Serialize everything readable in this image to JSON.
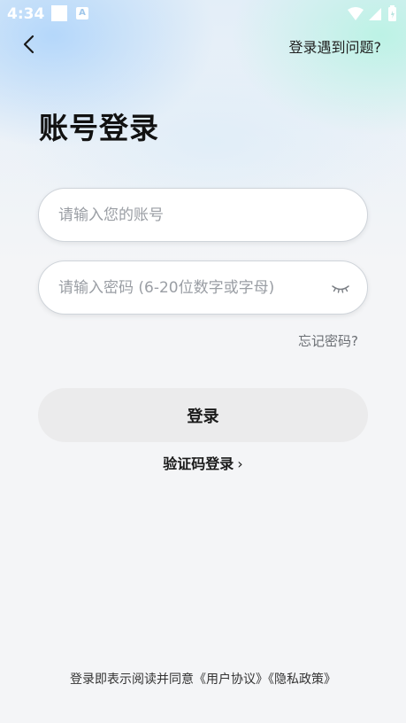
{
  "status_bar": {
    "time": "4:34",
    "notification_letter": "A"
  },
  "nav": {
    "help_link": "登录遇到问题?"
  },
  "page": {
    "title": "账号登录"
  },
  "form": {
    "account_placeholder": "请输入您的账号",
    "password_placeholder": "请输入密码 (6-20位数字或字母)",
    "forgot_password": "忘记密码?",
    "login_button": "登录",
    "code_login": "验证码登录",
    "code_login_chevron": "›"
  },
  "footer": {
    "agreement_prefix": "登录即表示阅读并同意",
    "user_agreement": "《用户协议》",
    "privacy_policy": "《隐私政策》"
  }
}
